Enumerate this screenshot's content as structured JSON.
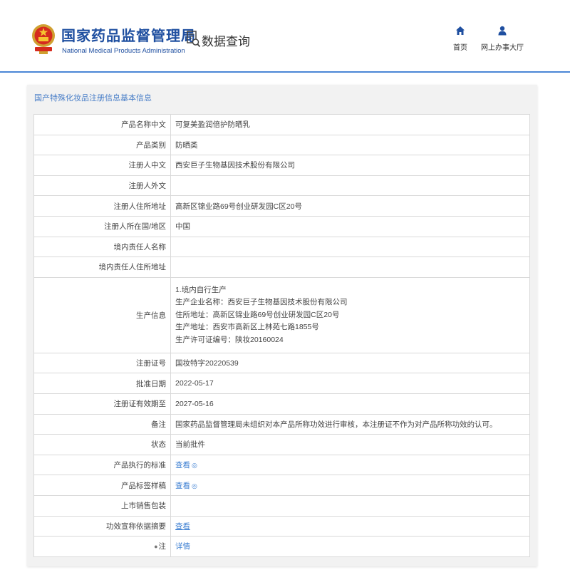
{
  "header": {
    "brand_cn": "国家药品监督管理局",
    "brand_en": "National Medical Products Administration",
    "query_label": "数据查询",
    "nav": {
      "home": "首页",
      "hall": "网上办事大厅"
    }
  },
  "panel": {
    "title": "国产特殊化妆品注册信息基本信息"
  },
  "rows": [
    {
      "label": "产品名称中文",
      "value": "可复美盈润倍护防晒乳"
    },
    {
      "label": "产品类别",
      "value": "防晒类"
    },
    {
      "label": "注册人中文",
      "value": "西安巨子生物基因技术股份有限公司"
    },
    {
      "label": "注册人外文",
      "value": ""
    },
    {
      "label": "注册人住所地址",
      "value": "高新区锦业路69号创业研发园C区20号"
    },
    {
      "label": "注册人所在国/地区",
      "value": "中国"
    },
    {
      "label": "境内责任人名称",
      "value": ""
    },
    {
      "label": "境内责任人住所地址",
      "value": ""
    }
  ],
  "production": {
    "label": "生产信息",
    "lines": [
      "1.境内自行生产",
      "生产企业名称：西安巨子生物基因技术股份有限公司",
      "住所地址：高新区锦业路69号创业研发园C区20号",
      "生产地址：西安市高新区上林苑七路1855号",
      "生产许可证编号：陕妆20160024"
    ]
  },
  "rows2": [
    {
      "label": "注册证号",
      "value": "国妆特字20220539"
    },
    {
      "label": "批准日期",
      "value": "2022-05-17"
    },
    {
      "label": "注册证有效期至",
      "value": "2027-05-16"
    },
    {
      "label": "备注",
      "value": "国家药品监督管理局未组织对本产品所称功效进行审核，本注册证不作为对产品所称功效的认可。"
    },
    {
      "label": "状态",
      "value": "当前批件"
    }
  ],
  "links": {
    "standard": {
      "label": "产品执行的标准",
      "link": "查看"
    },
    "label_sample": {
      "label": "产品标签样稿",
      "link": "查看"
    },
    "packaging": {
      "label": "上市销售包装",
      "value": ""
    },
    "efficacy": {
      "label": "功效宣称依据摘要",
      "link": "查看"
    },
    "note": {
      "label": "注",
      "link": "详情"
    }
  }
}
